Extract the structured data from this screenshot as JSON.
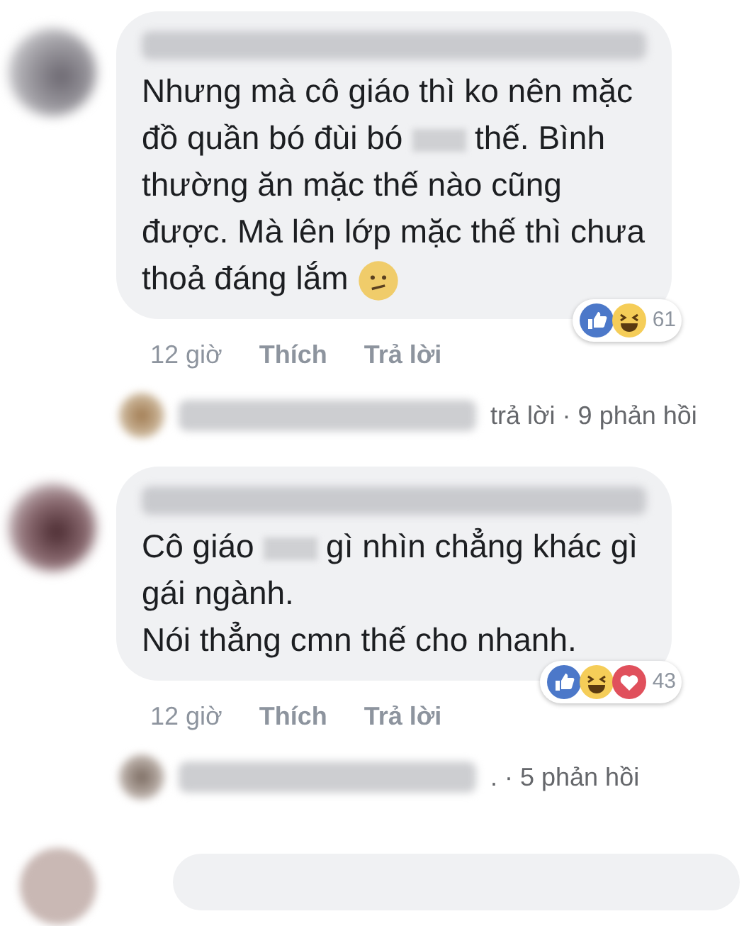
{
  "comments": [
    {
      "paragraphs": [
        [
          {
            "kind": "text",
            "text": "Nhưng mà cô giáo thì ko nên mặc đồ quần bó đùi bó "
          },
          {
            "kind": "blur"
          },
          {
            "kind": "text",
            "text": " thế. Bình thường ăn mặc thế nào cũng được. Mà lên lớp mặc thế thì chưa thoả đáng lắm "
          },
          {
            "kind": "emoji"
          }
        ]
      ],
      "time": "12 giờ",
      "like": "Thích",
      "reply": "Trả lời",
      "reactions": [
        {
          "kind": "like"
        },
        {
          "kind": "haha"
        }
      ],
      "reaction_count": "61",
      "replies_summary": "trả lời · 9 phản hồi"
    },
    {
      "paragraphs": [
        [
          {
            "kind": "text",
            "text": "Cô giáo "
          },
          {
            "kind": "blur"
          },
          {
            "kind": "text",
            "text": " gì nhìn chẳng khác gì gái ngành."
          }
        ],
        [
          {
            "kind": "text",
            "text": "Nói thẳng cmn thế cho nhanh."
          }
        ]
      ],
      "time": "12 giờ",
      "like": "Thích",
      "reply": "Trả lời",
      "reactions": [
        {
          "kind": "like"
        },
        {
          "kind": "haha"
        },
        {
          "kind": "love"
        }
      ],
      "reaction_count": "43",
      "replies_summary": ". · 5 phản hồi"
    }
  ]
}
